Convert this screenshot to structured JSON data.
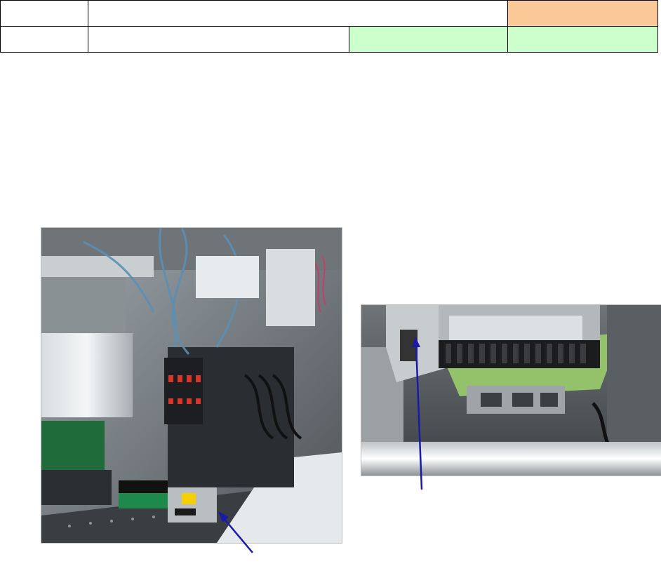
{
  "header_table": {
    "rows": [
      {
        "cells": [
          {
            "text": "",
            "fill": "#ffffff"
          },
          {
            "text": "",
            "fill": "#ffffff"
          },
          {
            "text": "",
            "fill": "#fbc897"
          }
        ]
      },
      {
        "cells": [
          {
            "text": "",
            "fill": "#ffffff"
          },
          {
            "text": "",
            "fill": "#ffffff"
          },
          {
            "text": "",
            "fill": "#ccffcc"
          },
          {
            "text": "",
            "fill": "#ccffcc"
          }
        ]
      }
    ]
  },
  "photos": [
    {
      "name": "placement-head-photo",
      "description_icon": "machine-photo"
    },
    {
      "name": "conveyor-board-photo",
      "description_icon": "machine-photo"
    }
  ],
  "colors": {
    "arrow": "#1a1aa8",
    "highlight_orange": "#fbc897",
    "highlight_green": "#ccffcc"
  }
}
